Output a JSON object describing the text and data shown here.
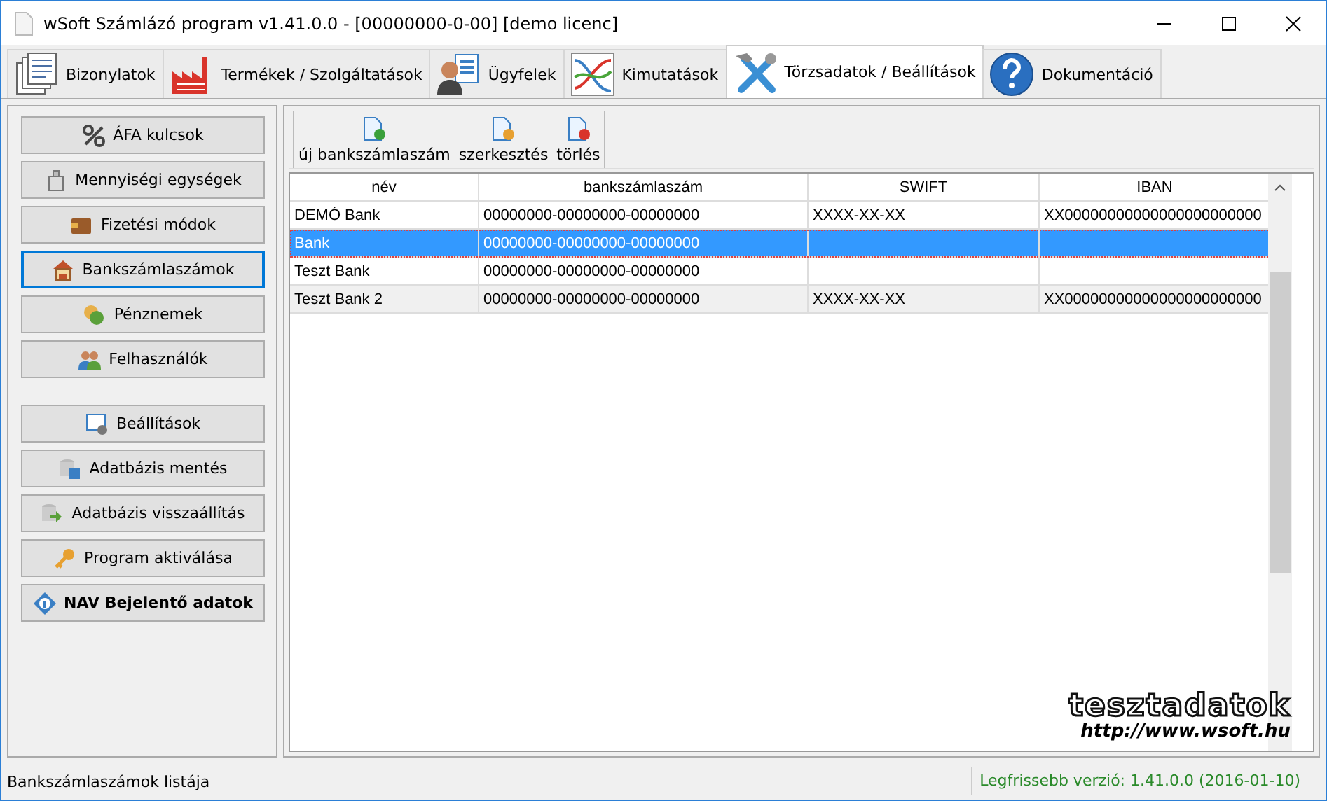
{
  "window": {
    "title": "wSoft Számlázó program v1.41.0.0 - [00000000-0-00] [demo licenc]"
  },
  "tabs": [
    {
      "label": "Bizonylatok",
      "selected": false
    },
    {
      "label": "Termékek / Szolgáltatások",
      "selected": false
    },
    {
      "label": "Ügyfelek",
      "selected": false
    },
    {
      "label": "Kimutatások",
      "selected": false
    },
    {
      "label": "Törzsadatok / Beállítások",
      "selected": true
    },
    {
      "label": "Dokumentáció",
      "selected": false
    }
  ],
  "sidebar": {
    "groups": [
      [
        {
          "label": "ÁFA kulcsok",
          "selected": false,
          "bold": false
        },
        {
          "label": "Mennyiségi egységek",
          "selected": false,
          "bold": false
        },
        {
          "label": "Fizetési módok",
          "selected": false,
          "bold": false
        },
        {
          "label": "Bankszámlaszámok",
          "selected": true,
          "bold": false
        },
        {
          "label": "Pénznemek",
          "selected": false,
          "bold": false
        },
        {
          "label": "Felhasználók",
          "selected": false,
          "bold": false
        }
      ],
      [
        {
          "label": "Beállítások",
          "selected": false,
          "bold": false
        },
        {
          "label": "Adatbázis mentés",
          "selected": false,
          "bold": false
        },
        {
          "label": "Adatbázis visszaállítás",
          "selected": false,
          "bold": false
        },
        {
          "label": "Program aktiválása",
          "selected": false,
          "bold": false
        },
        {
          "label": "NAV Bejelentő adatok",
          "selected": false,
          "bold": true
        }
      ]
    ]
  },
  "toolbar": [
    "új bankszámlaszám",
    "szerkesztés",
    "törlés"
  ],
  "table": {
    "columns": [
      "név",
      "bankszámlaszám",
      "SWIFT",
      "IBAN"
    ],
    "rows": [
      {
        "cells": [
          "DEMÓ Bank",
          "00000000-00000000-00000000",
          "XXXX-XX-XX",
          "XX00000000000000000000000"
        ],
        "selected": false
      },
      {
        "cells": [
          "Bank",
          "00000000-00000000-00000000",
          "",
          ""
        ],
        "selected": true
      },
      {
        "cells": [
          "Teszt Bank",
          "00000000-00000000-00000000",
          "",
          ""
        ],
        "selected": false
      },
      {
        "cells": [
          "Teszt Bank 2",
          "00000000-00000000-00000000",
          "XXXX-XX-XX",
          "XX00000000000000000000000"
        ],
        "selected": false
      }
    ]
  },
  "watermark": {
    "title": "tesztadatok",
    "url": "http://www.wsoft.hu"
  },
  "status_bar": {
    "message": "Bankszámlaszámok listája",
    "version": "Legfrissebb verzió: 1.41.0.0 (2016-01-10)"
  }
}
